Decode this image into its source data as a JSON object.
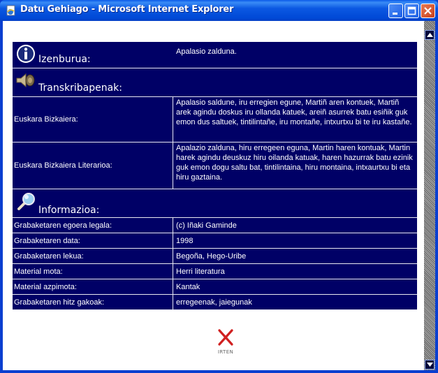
{
  "window": {
    "title": "Datu Gehiago - Microsoft Internet Explorer"
  },
  "header": {
    "label": "Izenburua:",
    "value": "Apalasio zalduna."
  },
  "transcripts": {
    "label": "Transkribapenak:",
    "rows": [
      {
        "key": "Euskara Bizkaiera:",
        "value": "Apalasio saldune, iru erregien egune, Martiñ aren kontuek, Martiñ arek agindu doskus iru ollanda katuek, areiñ asurrek batu esiñik guk emon dus saltuek, tintilintañe, iru montañe, intxurtxu bi te iru kastañe."
      },
      {
        "key": "Euskara Bizkaiera Literarioa:",
        "value": "Apalazio zalduna, hiru erregeen eguna, Martin haren kontuak, Martin harek agindu deuskuz hiru oilanda katuak, haren hazurrak batu ezinik guk emon dogu saltu bat, tintilintaina, hiru montaina, intxaurtxu bi eta hiru gaztaina."
      }
    ]
  },
  "info": {
    "label": "Informazioa:",
    "rows": [
      {
        "key": "Grabaketaren egoera legala:",
        "value": "(c) Iñaki Gaminde"
      },
      {
        "key": "Grabaketaren data:",
        "value": "1998"
      },
      {
        "key": "Grabaketaren lekua:",
        "value": "Begoña, Hego-Uribe"
      },
      {
        "key": "Material mota:",
        "value": "Herri literatura"
      },
      {
        "key": "Material azpimota:",
        "value": "Kantak"
      },
      {
        "key": "Grabaketaren hitz gakoak:",
        "value": "erregeenak, jaiegunak"
      }
    ]
  },
  "exit": {
    "label": "IRTEN"
  }
}
